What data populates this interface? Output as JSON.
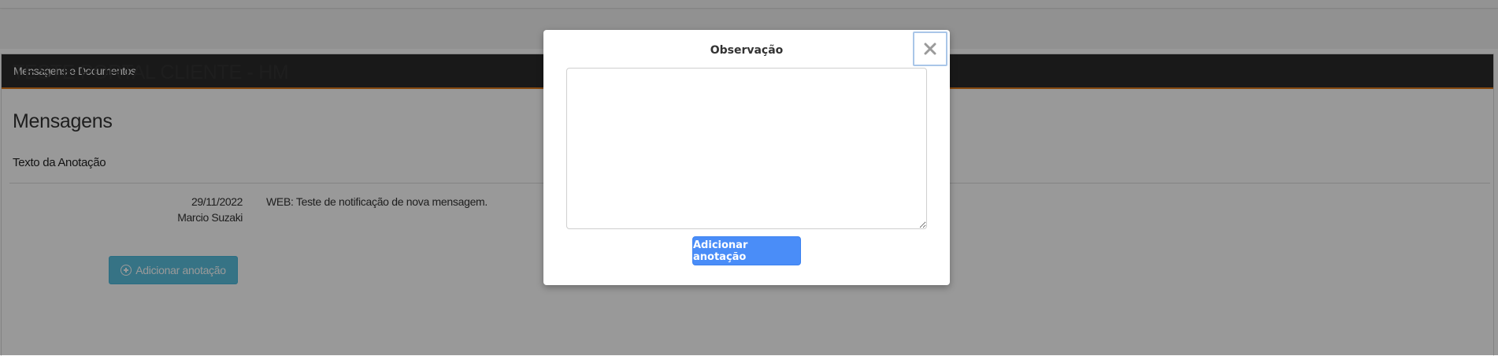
{
  "panel": {
    "header": "Mensagens e Documentos",
    "client_name": "TESTE PORTAL CLIENTE - HM",
    "section_title": "Mensagens",
    "column_header": "Texto da Anotação"
  },
  "messages": [
    {
      "date": "29/11/2022",
      "author": "Marcio Suzaki",
      "text": "WEB: Teste de notificação de nova mensagem."
    }
  ],
  "add_button": {
    "label": "Adicionar anotação",
    "icon": "plus-circle-icon"
  },
  "modal": {
    "title": "Observação",
    "textarea_value": "",
    "submit_label": "Adicionar anotação",
    "close_icon": "close-icon"
  },
  "colors": {
    "header_bg": "#2b2b2b",
    "header_accent": "#e07b1a",
    "info_button": "#5bc0de",
    "primary_button": "#4a8df8",
    "overlay": "rgba(0,0,0,0.4)"
  }
}
